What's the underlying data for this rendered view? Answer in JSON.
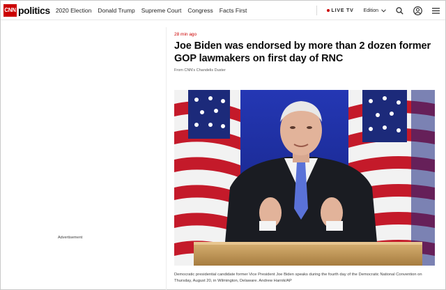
{
  "header": {
    "logo": "CNN",
    "section": "politics",
    "nav": [
      "2020 Election",
      "Donald Trump",
      "Supreme Court",
      "Congress",
      "Facts First"
    ],
    "live_label": "LIVE TV",
    "edition_label": "Edition"
  },
  "sidebar": {
    "ad_label": "Advertisement"
  },
  "article": {
    "timestamp": "28 min ago",
    "headline": "Joe Biden was endorsed by more than 2 dozen former GOP lawmakers on first day of RNC",
    "byline": "From CNN's Chandelis Duster",
    "caption": "Democratic presidential candidate former Vice President Joe Biden speaks during the fourth day of the Democratic National Convention on Thursday, August 20, in Wilmington, Delaware. Andrew Harnik/AP"
  },
  "colors": {
    "brand": "#cc0000",
    "photo_background": "#1a2a8c"
  },
  "icons": [
    "chevron-down-icon",
    "search-icon",
    "account-icon",
    "menu-icon"
  ]
}
